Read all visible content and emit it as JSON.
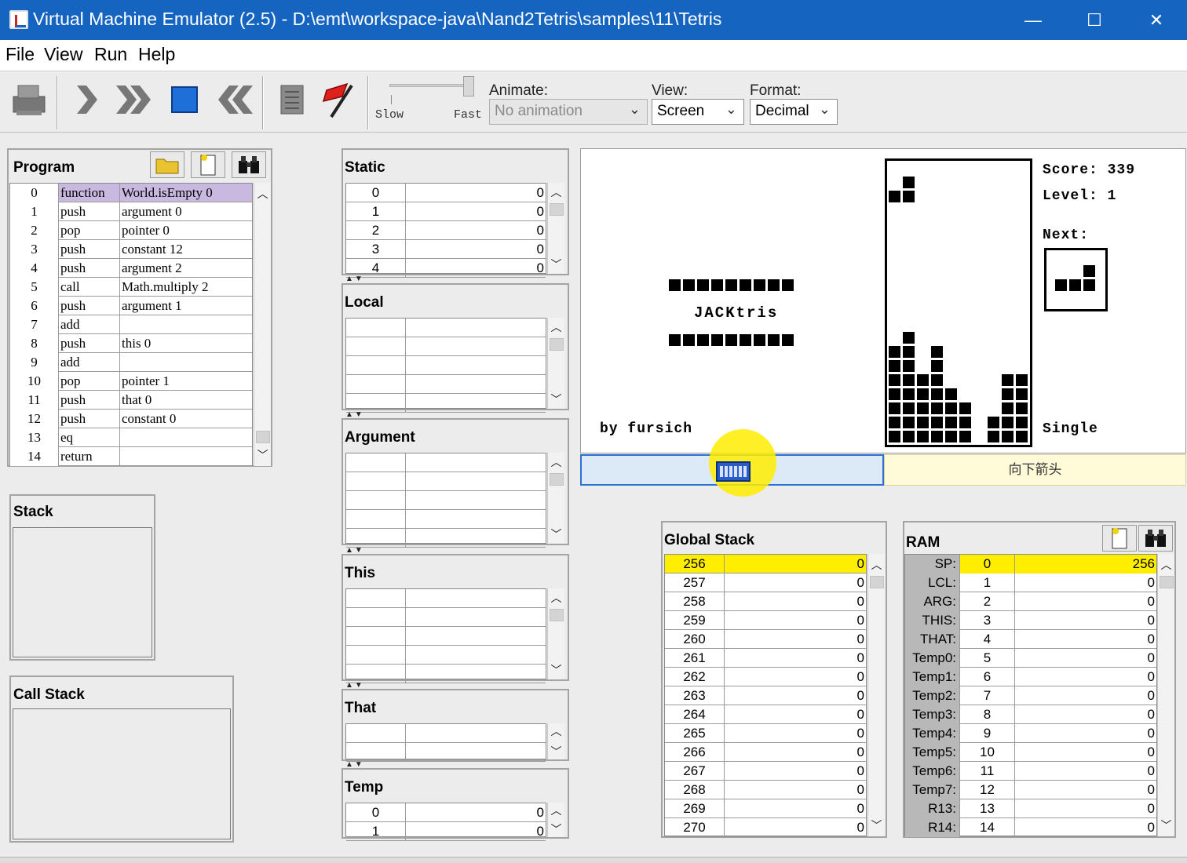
{
  "window": {
    "title": "Virtual Machine Emulator (2.5) - D:\\emt\\workspace-java\\Nand2Tetris\\samples\\11\\Tetris",
    "minimize": "—",
    "maximize": "☐",
    "close": "✕"
  },
  "menu": [
    "File",
    "View",
    "Run",
    "Help"
  ],
  "toolbar": {
    "speed_slow": "Slow",
    "speed_fast": "Fast",
    "speed_value": 1.0,
    "animate_label": "Animate:",
    "animate_value": "No animation",
    "view_label": "View:",
    "view_value": "Screen",
    "format_label": "Format:",
    "format_value": "Decimal",
    "icons": [
      "load-icon",
      "step-icon",
      "run-icon",
      "stop-icon",
      "reset-icon",
      "script-icon",
      "breakpoint-flag-icon"
    ]
  },
  "program": {
    "title": "Program",
    "rows": [
      {
        "n": "0",
        "cmd": "function",
        "arg": "World.isEmpty 0"
      },
      {
        "n": "1",
        "cmd": "push",
        "arg": "argument 0"
      },
      {
        "n": "2",
        "cmd": "pop",
        "arg": "pointer 0"
      },
      {
        "n": "3",
        "cmd": "push",
        "arg": "constant 12"
      },
      {
        "n": "4",
        "cmd": "push",
        "arg": "argument 2"
      },
      {
        "n": "5",
        "cmd": "call",
        "arg": "Math.multiply 2"
      },
      {
        "n": "6",
        "cmd": "push",
        "arg": "argument 1"
      },
      {
        "n": "7",
        "cmd": "add",
        "arg": ""
      },
      {
        "n": "8",
        "cmd": "push",
        "arg": "this 0"
      },
      {
        "n": "9",
        "cmd": "add",
        "arg": ""
      },
      {
        "n": "10",
        "cmd": "pop",
        "arg": "pointer 1"
      },
      {
        "n": "11",
        "cmd": "push",
        "arg": "that 0"
      },
      {
        "n": "12",
        "cmd": "push",
        "arg": "constant 0"
      },
      {
        "n": "13",
        "cmd": "eq",
        "arg": ""
      },
      {
        "n": "14",
        "cmd": "return",
        "arg": ""
      }
    ]
  },
  "stack": {
    "title": "Stack"
  },
  "call_stack": {
    "title": "Call Stack"
  },
  "static": {
    "title": "Static",
    "rows": [
      [
        "0",
        "0"
      ],
      [
        "1",
        "0"
      ],
      [
        "2",
        "0"
      ],
      [
        "3",
        "0"
      ],
      [
        "4",
        "0"
      ]
    ]
  },
  "local": {
    "title": "Local"
  },
  "argument": {
    "title": "Argument"
  },
  "this_seg": {
    "title": "This"
  },
  "that_seg": {
    "title": "That"
  },
  "temp": {
    "title": "Temp",
    "rows": [
      [
        "0",
        "0"
      ],
      [
        "1",
        "0"
      ]
    ]
  },
  "screen": {
    "logo": "JACKtris",
    "byline": "by fursich",
    "score": "Score: 339",
    "level": "Level: 1",
    "next": "Next:",
    "mode": "Single"
  },
  "keyboard": {
    "key_label": "向下箭头"
  },
  "global_stack": {
    "title": "Global Stack",
    "rows": [
      [
        "256",
        "0"
      ],
      [
        "257",
        "0"
      ],
      [
        "258",
        "0"
      ],
      [
        "259",
        "0"
      ],
      [
        "260",
        "0"
      ],
      [
        "261",
        "0"
      ],
      [
        "262",
        "0"
      ],
      [
        "263",
        "0"
      ],
      [
        "264",
        "0"
      ],
      [
        "265",
        "0"
      ],
      [
        "266",
        "0"
      ],
      [
        "267",
        "0"
      ],
      [
        "268",
        "0"
      ],
      [
        "269",
        "0"
      ],
      [
        "270",
        "0"
      ]
    ]
  },
  "ram": {
    "title": "RAM",
    "rows": [
      [
        "SP:",
        "0",
        "256"
      ],
      [
        "LCL:",
        "1",
        "0"
      ],
      [
        "ARG:",
        "2",
        "0"
      ],
      [
        "THIS:",
        "3",
        "0"
      ],
      [
        "THAT:",
        "4",
        "0"
      ],
      [
        "Temp0:",
        "5",
        "0"
      ],
      [
        "Temp1:",
        "6",
        "0"
      ],
      [
        "Temp2:",
        "7",
        "0"
      ],
      [
        "Temp3:",
        "8",
        "0"
      ],
      [
        "Temp4:",
        "9",
        "0"
      ],
      [
        "Temp5:",
        "10",
        "0"
      ],
      [
        "Temp6:",
        "11",
        "0"
      ],
      [
        "Temp7:",
        "12",
        "0"
      ],
      [
        "R13:",
        "13",
        "0"
      ],
      [
        "R14:",
        "14",
        "0"
      ]
    ]
  },
  "colors": {
    "titlebar": "#1565c0",
    "highlight": "#ffee00",
    "program_highlight": "#c9b8e0",
    "keyboard_field": "#dce9f7",
    "key_label_bg": "#fffbd8"
  }
}
